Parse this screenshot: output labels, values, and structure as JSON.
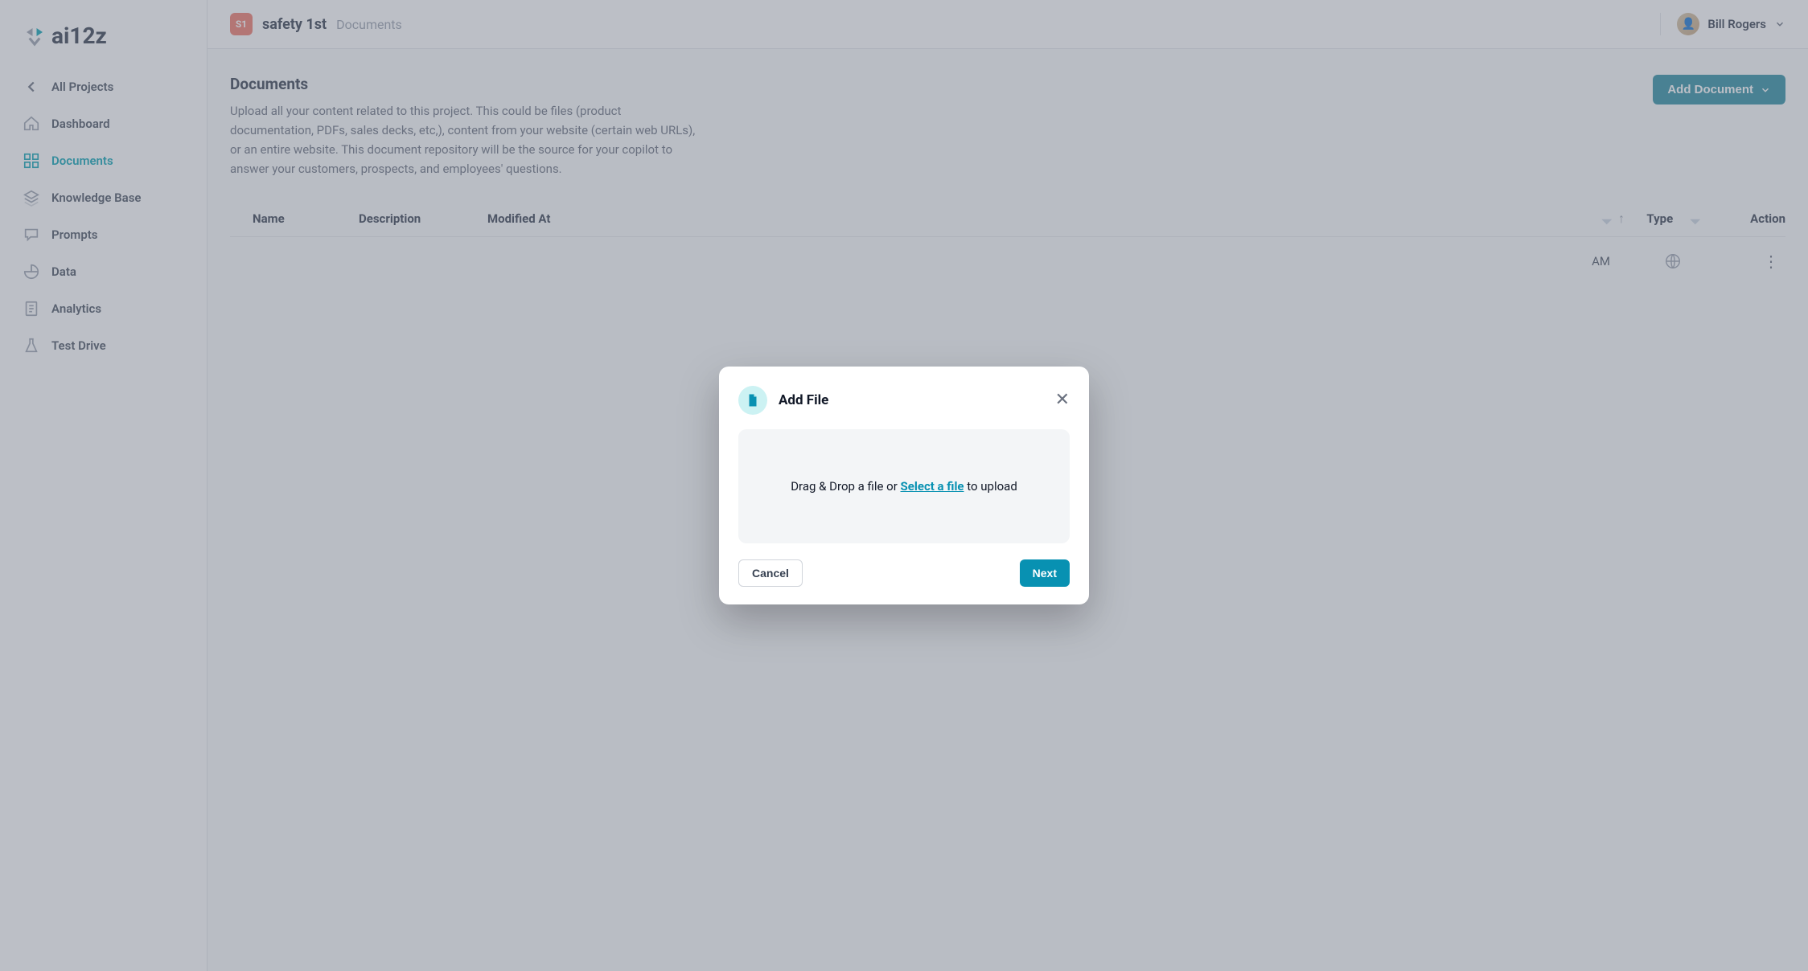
{
  "logo": {
    "text": "ai12z"
  },
  "sidebar": {
    "back": "All Projects",
    "items": [
      {
        "label": "Dashboard"
      },
      {
        "label": "Documents"
      },
      {
        "label": "Knowledge Base"
      },
      {
        "label": "Prompts"
      },
      {
        "label": "Data"
      },
      {
        "label": "Analytics"
      },
      {
        "label": "Test Drive"
      }
    ]
  },
  "header": {
    "project_badge": "S1",
    "project_name": "safety 1st",
    "section": "Documents",
    "user_name": "Bill Rogers"
  },
  "page": {
    "title": "Documents",
    "description": "Upload all your content related to this project. This could be files (product documentation, PDFs, sales decks, etc,), content from your website (certain web URLs), or an entire website. This document repository will be the source for your copilot to answer your customers, prospects, and employees' questions.",
    "add_document_label": "Add Document"
  },
  "table": {
    "columns": {
      "name": "Name",
      "description": "Description",
      "modified": "Modified At",
      "type": "Type",
      "action": "Action"
    },
    "rows": [
      {
        "partial_time": "AM",
        "type_icon": "globe"
      }
    ]
  },
  "modal": {
    "title": "Add File",
    "drop_prefix": "Drag & Drop a file or ",
    "select_link": "Select a file",
    "drop_suffix": " to upload",
    "cancel": "Cancel",
    "next": "Next"
  }
}
